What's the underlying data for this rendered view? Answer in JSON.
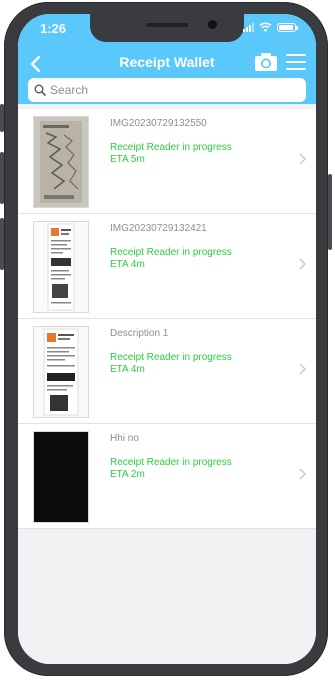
{
  "status_bar": {
    "time": "1:26"
  },
  "header": {
    "title": "Receipt Wallet"
  },
  "search": {
    "placeholder": "Search"
  },
  "receipts": [
    {
      "title": "IMG20230729132550",
      "status": "Receipt Reader in progress",
      "eta": "ETA 5m"
    },
    {
      "title": "IMG20230729132421",
      "status": "Receipt Reader in progress",
      "eta": "ETA 4m"
    },
    {
      "title": "Description 1",
      "status": "Receipt Reader in progress",
      "eta": "ETA 4m"
    },
    {
      "title": "Hhi no",
      "status": "Receipt Reader in progress",
      "eta": "ETA 2m"
    }
  ],
  "colors": {
    "header_bg": "#5ac8fa",
    "status_green": "#2ecc40",
    "title_gray": "#8e8e93",
    "frame": "#3a3b3e"
  },
  "icons": [
    "back-icon",
    "camera-icon",
    "menu-icon",
    "search-icon",
    "chevron-right-icon",
    "signal-icon",
    "wifi-icon",
    "battery-icon"
  ]
}
